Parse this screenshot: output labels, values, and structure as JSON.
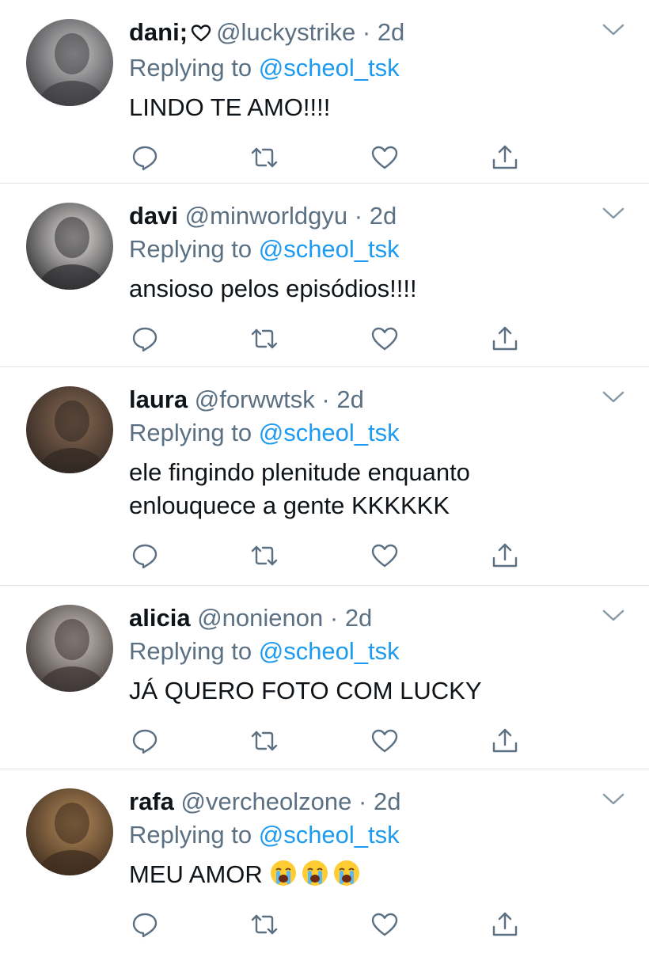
{
  "tweets": [
    {
      "display_name": "dani;",
      "has_heart": true,
      "handle": "@luckystrike",
      "dot": "·",
      "time": "2d",
      "replying_prefix": "Replying to",
      "replying_to": "@scheol_tsk",
      "text_lines": [
        "LINDO TE AMO!!!!"
      ],
      "avatar_colors": [
        "#c9c9c9",
        "#3c3c40"
      ]
    },
    {
      "display_name": "davi",
      "has_heart": false,
      "handle": "@minworldgyu",
      "dot": "·",
      "time": "2d",
      "replying_prefix": "Replying to",
      "replying_to": "@scheol_tsk",
      "text_lines": [
        "ansioso pelos episódios!!!!"
      ],
      "avatar_colors": [
        "#e9e7e4",
        "#2b2a2c"
      ]
    },
    {
      "display_name": "laura",
      "has_heart": false,
      "handle": "@forwwtsk",
      "dot": "·",
      "time": "2d",
      "replying_prefix": "Replying to",
      "replying_to": "@scheol_tsk",
      "text_lines": [
        "ele fingindo plenitude enquanto",
        "enlouquece a gente KKKKKK"
      ],
      "avatar_colors": [
        "#8a6a52",
        "#2f2622"
      ]
    },
    {
      "display_name": "alicia",
      "has_heart": false,
      "handle": "@nonienon",
      "dot": "·",
      "time": "2d",
      "replying_prefix": "Replying to",
      "replying_to": "@scheol_tsk",
      "text_lines": [
        "JÁ QUERO FOTO COM LUCKY"
      ],
      "avatar_colors": [
        "#cfc7c0",
        "#3a3230"
      ]
    },
    {
      "display_name": "rafa",
      "has_heart": false,
      "handle": "@vercheolzone",
      "dot": "·",
      "time": "2d",
      "replying_prefix": "Replying to",
      "replying_to": "@scheol_tsk",
      "text_lines": [
        "MEU AMOR"
      ],
      "emoji_count": 3,
      "emoji_name": "loudly-crying-face",
      "avatar_colors": [
        "#b58a5a",
        "#3a2a1c"
      ]
    }
  ],
  "icons": {
    "reply": "reply-icon",
    "retweet": "retweet-icon",
    "like": "like-icon",
    "share": "share-icon",
    "more": "chevron-down-icon"
  },
  "colors": {
    "mention": "#1d9bf0",
    "secondary_text": "#5b7083",
    "divider": "#dfe3e6",
    "icon": "#5b7083"
  }
}
